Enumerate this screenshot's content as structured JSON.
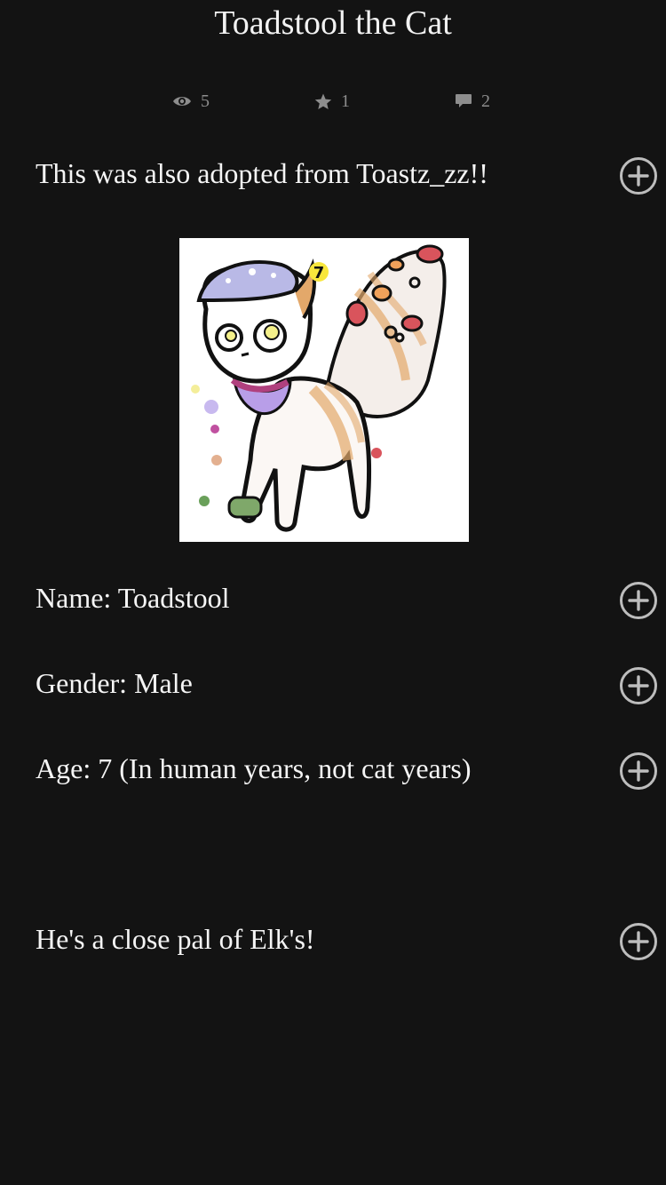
{
  "page": {
    "title": "Toadstool the Cat"
  },
  "stats": {
    "views": "5",
    "stars": "1",
    "comments": "2"
  },
  "paragraphs": [
    "This was also adopted from Toastz_zz!!",
    "Name: Toadstool",
    "Gender: Male",
    "Age: 7 (In human years, not cat years)",
    "He's a close pal of Elk's!"
  ],
  "artwork": {
    "badge_number": "7"
  },
  "colors": {
    "background": "#131313",
    "text": "#f5f5f5",
    "muted": "#8d8d8d",
    "icon": "#bdbdbd"
  }
}
